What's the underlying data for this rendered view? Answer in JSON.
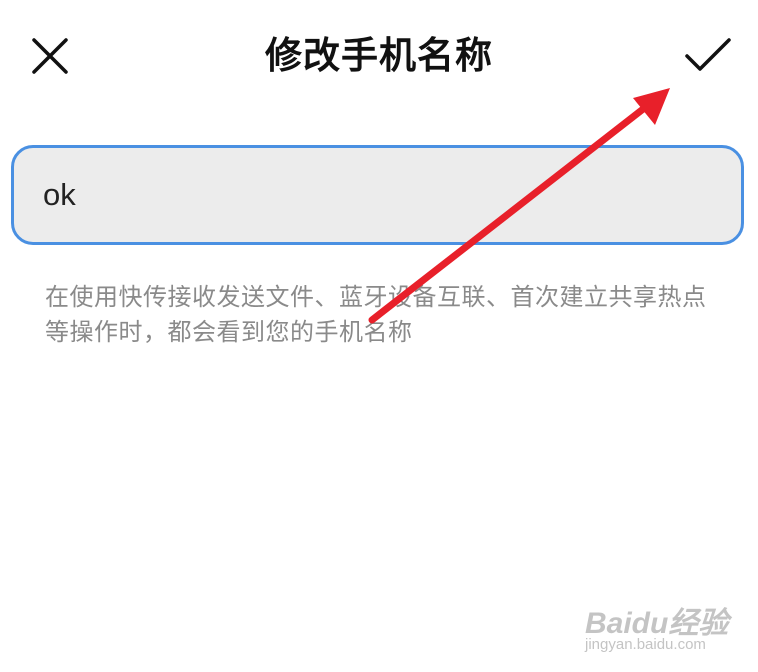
{
  "header": {
    "title": "修改手机名称",
    "close_icon": "close-icon",
    "confirm_icon": "check-icon"
  },
  "name_input": {
    "value": "ok",
    "border_color": "#4a90e2"
  },
  "hint": {
    "text": "在使用快传接收发送文件、蓝牙设备互联、首次建立共享热点等操作时，都会看到您的手机名称"
  },
  "annotation": {
    "type": "arrow",
    "color": "#e8202a"
  },
  "watermark": {
    "brand": "Baidu经验",
    "url": "jingyan.baidu.com"
  }
}
